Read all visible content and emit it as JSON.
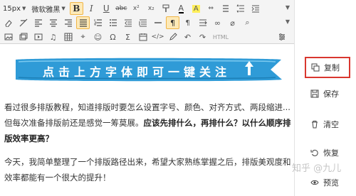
{
  "toolbar": {
    "font_size": "15px",
    "font_family": "微软雅黑",
    "html_label": "HTML"
  },
  "banner": {
    "text": "点击上方字体即可一键关注",
    "color": "#2f9bd7",
    "icon": "up-arrow-icon"
  },
  "content": {
    "p1_normal": "看过很多排版教程，知道排版时要怎么设置字号、颜色、对齐方式、两段缩进...但每次准备排版前还是感觉一筹莫展。",
    "p1_bold": "应该先排什么，再排什么？以什么顺序排版效率更高？",
    "p2": "今天，我简单整理了一个排版路径出来，希望大家熟练掌握之后，排版美观度和效率都能有一个很大的提升！"
  },
  "sidebar": {
    "copy_label": "复制",
    "save_label": "保存",
    "clear_label": "清空",
    "restore_label": "恢复",
    "preview_label": "预览"
  },
  "watermark": "知乎 @九儿",
  "colors": {
    "selected_border": "#d9372f",
    "active_button": "#fde9b7"
  }
}
